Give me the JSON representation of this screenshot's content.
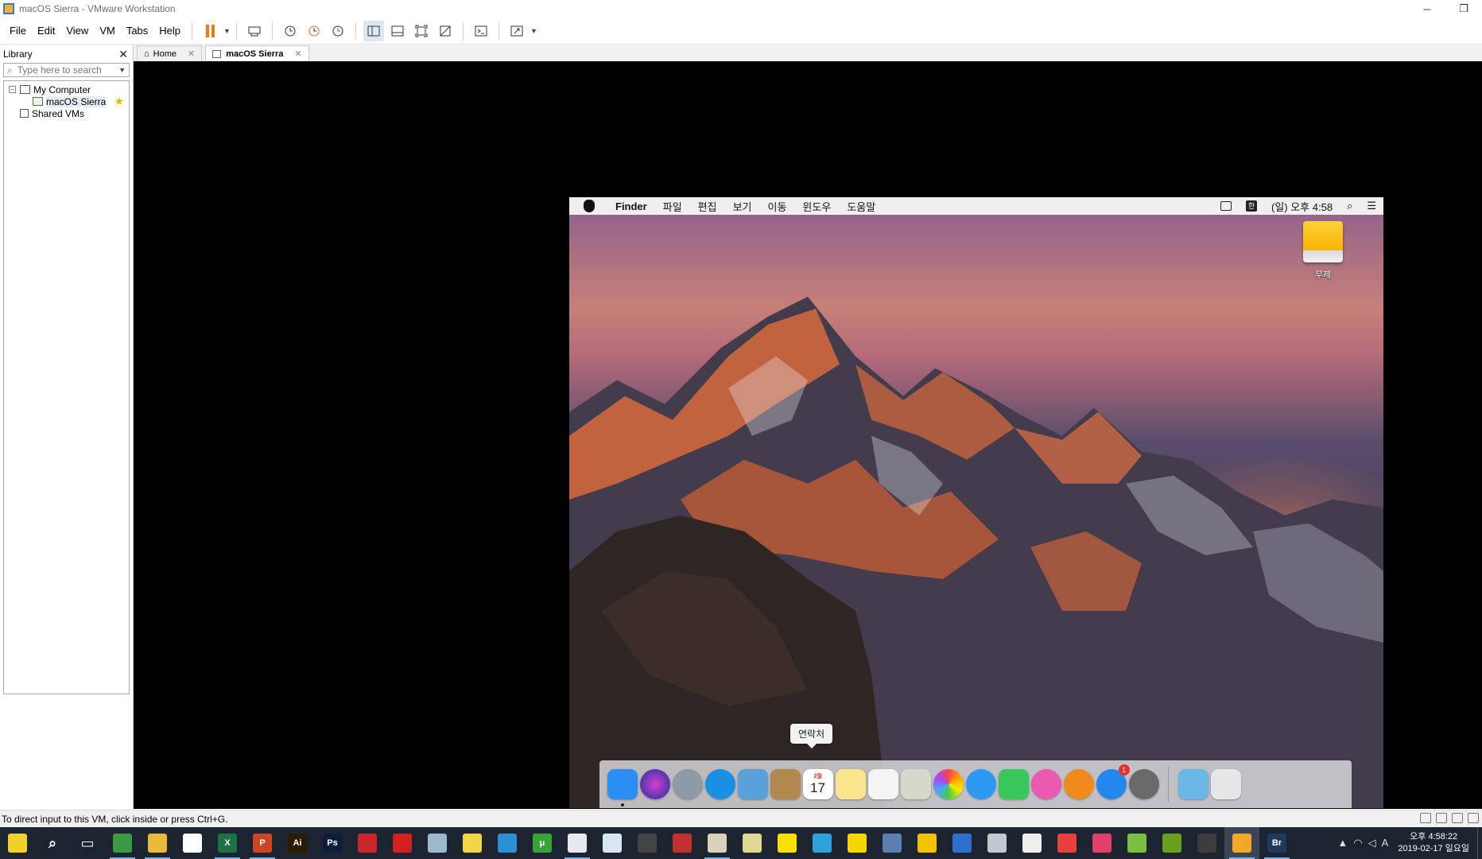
{
  "window": {
    "title": "macOS Sierra - VMware Workstation"
  },
  "menu": {
    "items": [
      "File",
      "Edit",
      "View",
      "VM",
      "Tabs",
      "Help"
    ]
  },
  "library": {
    "title": "Library",
    "search_placeholder": "Type here to search",
    "tree": {
      "my_computer": "My Computer",
      "vm": "macOS Sierra",
      "shared": "Shared VMs"
    }
  },
  "tabs": [
    {
      "label": "Home"
    },
    {
      "label": "macOS Sierra"
    }
  ],
  "mac": {
    "menubar": {
      "app": "Finder",
      "items": [
        "파일",
        "편집",
        "보기",
        "이동",
        "윈도우",
        "도움말"
      ],
      "clock": "(일) 오후 4:58",
      "input_method": "한"
    },
    "desktop_drive": "무제",
    "dock_tooltip": "연락처",
    "dock": {
      "calendar_day": "17",
      "calendar_month": "2월",
      "appstore_badge": "1",
      "apps": [
        {
          "name": "Finder",
          "icon": "finder-icon",
          "color": "#2b8ef3"
        },
        {
          "name": "Siri",
          "icon": "siri-icon",
          "color": "#3b3b9c"
        },
        {
          "name": "Launchpad",
          "icon": "launchpad-icon",
          "color": "#8e9aa6"
        },
        {
          "name": "Safari",
          "icon": "safari-icon",
          "color": "#1a8fe3"
        },
        {
          "name": "Mail",
          "icon": "mail-icon",
          "color": "#5aa0d8"
        },
        {
          "name": "Contacts",
          "icon": "contacts-icon",
          "color": "#b08850"
        },
        {
          "name": "Calendar",
          "icon": "calendar-icon",
          "color": "#ffffff"
        },
        {
          "name": "Notes",
          "icon": "notes-icon",
          "color": "#f8e58c"
        },
        {
          "name": "Reminders",
          "icon": "reminders-icon",
          "color": "#f4f4f4"
        },
        {
          "name": "Preview",
          "icon": "preview-icon",
          "color": "#d8d8c8"
        },
        {
          "name": "Photos",
          "icon": "photos-icon",
          "color": "#f5f5f5"
        },
        {
          "name": "Messages",
          "icon": "messages-icon",
          "color": "#2c9af0"
        },
        {
          "name": "FaceTime",
          "icon": "facetime-icon",
          "color": "#3ac75a"
        },
        {
          "name": "iTunes",
          "icon": "itunes-icon",
          "color": "#e95ab0"
        },
        {
          "name": "iBooks",
          "icon": "ibooks-icon",
          "color": "#f08a1c"
        },
        {
          "name": "App Store",
          "icon": "appstore-icon",
          "color": "#2288ee"
        },
        {
          "name": "System Preferences",
          "icon": "gear-icon",
          "color": "#6a6a6a"
        }
      ],
      "right": [
        {
          "name": "Downloads",
          "icon": "downloads-folder-icon",
          "color": "#6ab8e6"
        },
        {
          "name": "Trash",
          "icon": "trash-icon",
          "color": "#e6e6e6"
        }
      ]
    }
  },
  "status": {
    "message": "To direct input to this VM, click inside or press Ctrl+G."
  },
  "taskbar": {
    "apps": [
      {
        "name": "homer",
        "color": "#f2cf2a",
        "text": ""
      },
      {
        "name": "search",
        "color": "transparent",
        "text": "⌕"
      },
      {
        "name": "task-view",
        "color": "transparent",
        "text": "▭"
      },
      {
        "name": "chrome",
        "color": "#3b9b45",
        "text": ""
      },
      {
        "name": "file-explorer",
        "color": "#e8b93a",
        "text": ""
      },
      {
        "name": "mail",
        "color": "#ffffff",
        "text": ""
      },
      {
        "name": "excel",
        "color": "#1e7145",
        "text": "X"
      },
      {
        "name": "powerpoint",
        "color": "#d04423",
        "text": "P"
      },
      {
        "name": "illustrator",
        "color": "#2a1a00",
        "text": "Ai"
      },
      {
        "name": "photoshop",
        "color": "#0c1f3a",
        "text": "Ps"
      },
      {
        "name": "app-red",
        "color": "#c8262a",
        "text": ""
      },
      {
        "name": "acrobat",
        "color": "#d21f1f",
        "text": ""
      },
      {
        "name": "app-gray",
        "color": "#9cb8cc",
        "text": ""
      },
      {
        "name": "app-yellow",
        "color": "#f2d544",
        "text": ""
      },
      {
        "name": "app-blue",
        "color": "#2b8fd0",
        "text": ""
      },
      {
        "name": "utorrent",
        "color": "#38a336",
        "text": "μ"
      },
      {
        "name": "app-white",
        "color": "#e8e8f0",
        "text": ""
      },
      {
        "name": "onedrive",
        "color": "#d8e6f2",
        "text": ""
      },
      {
        "name": "app-dark",
        "color": "#444",
        "text": ""
      },
      {
        "name": "app-stripes",
        "color": "#c42f2f",
        "text": ""
      },
      {
        "name": "app-book",
        "color": "#d8d2b8",
        "text": ""
      },
      {
        "name": "app-dropbox",
        "color": "#e0d890",
        "text": ""
      },
      {
        "name": "kakaotalk",
        "color": "#f9e000",
        "text": ""
      },
      {
        "name": "telegram",
        "color": "#2fa3d9",
        "text": ""
      },
      {
        "name": "sticky-notes",
        "color": "#f6d600",
        "text": ""
      },
      {
        "name": "app-screen",
        "color": "#5a7fb0",
        "text": ""
      },
      {
        "name": "app-yellow-circle",
        "color": "#f2c200",
        "text": ""
      },
      {
        "name": "app-shield",
        "color": "#2c6fcf",
        "text": ""
      },
      {
        "name": "app-chart",
        "color": "#c0c8d0",
        "text": ""
      },
      {
        "name": "app-search-doc",
        "color": "#eeeeee",
        "text": ""
      },
      {
        "name": "app-redwhite",
        "color": "#e84040",
        "text": ""
      },
      {
        "name": "app-pink",
        "color": "#e0406a",
        "text": ""
      },
      {
        "name": "app-pen",
        "color": "#7ac040",
        "text": ""
      },
      {
        "name": "app-green",
        "color": "#6aa020",
        "text": ""
      },
      {
        "name": "app-monitor",
        "color": "#3c3c3c",
        "text": ""
      },
      {
        "name": "vmware",
        "color": "#f2a72a",
        "text": ""
      },
      {
        "name": "bridge",
        "color": "#1d3c5c",
        "text": "Br"
      }
    ],
    "clock_time": "오후 4:58:22",
    "clock_date": "2019-02-17 일요일",
    "ime": "A"
  }
}
